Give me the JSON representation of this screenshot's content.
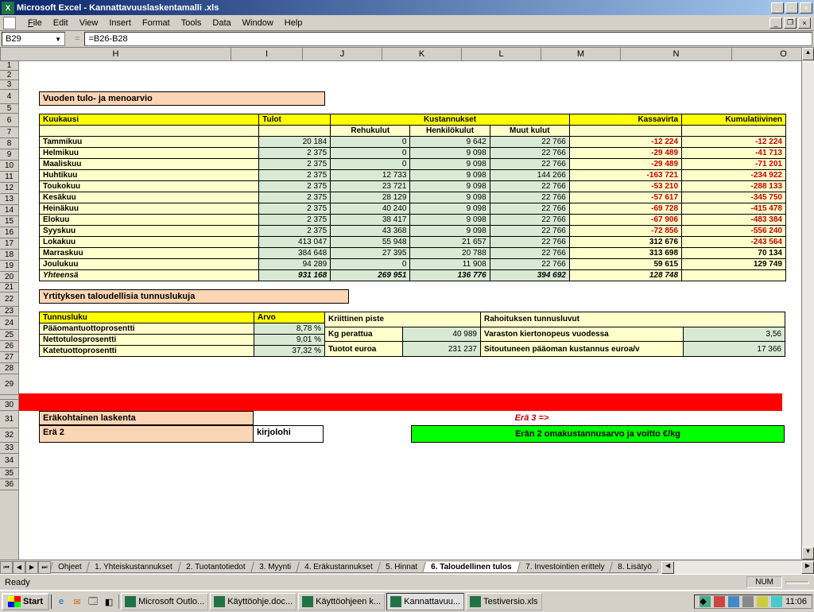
{
  "window": {
    "title": "Microsoft Excel - Kannattavuuslaskentamalli .xls"
  },
  "menu": {
    "file": "File",
    "edit": "Edit",
    "view": "View",
    "insert": "Insert",
    "format": "Format",
    "tools": "Tools",
    "data": "Data",
    "window": "Window",
    "help": "Help"
  },
  "namebox": "B29",
  "formula": "=B26-B28",
  "cols": [
    "H",
    "I",
    "J",
    "K",
    "L",
    "M",
    "N",
    "O"
  ],
  "rows": [
    "1",
    "2",
    "3",
    "4",
    "5",
    "6",
    "7",
    "8",
    "9",
    "10",
    "11",
    "12",
    "13",
    "14",
    "15",
    "16",
    "17",
    "18",
    "19",
    "20",
    "21",
    "22",
    "23",
    "24",
    "25",
    "26",
    "27",
    "28",
    "29",
    "",
    "30",
    "31",
    "32",
    "33",
    "34",
    "35",
    "36"
  ],
  "sec1_title": "Vuoden tulo- ja menoarvio",
  "headers": {
    "kuukausi": "Kuukausi",
    "tulot": "Tulot",
    "kustannukset": "Kustannukset",
    "rehu": "Rehukulut",
    "henkilo": "Henkilökulut",
    "muut": "Muut kulut",
    "kassa": "Kassavirta",
    "kumul": "Kumulatiivinen"
  },
  "months": [
    {
      "name": "Tammikuu",
      "tulot": "20 184",
      "rehu": "0",
      "henk": "9 642",
      "muut": "22 766",
      "kassa": "-12 224",
      "kumul": "-12 224"
    },
    {
      "name": "Helmikuu",
      "tulot": "2 375",
      "rehu": "0",
      "henk": "9 098",
      "muut": "22 766",
      "kassa": "-29 489",
      "kumul": "-41 713"
    },
    {
      "name": "Maaliskuu",
      "tulot": "2 375",
      "rehu": "0",
      "henk": "9 098",
      "muut": "22 766",
      "kassa": "-29 489",
      "kumul": "-71 201"
    },
    {
      "name": "Huhtikuu",
      "tulot": "2 375",
      "rehu": "12 733",
      "henk": "9 098",
      "muut": "144 266",
      "kassa": "-163 721",
      "kumul": "-234 922"
    },
    {
      "name": "Toukokuu",
      "tulot": "2 375",
      "rehu": "23 721",
      "henk": "9 098",
      "muut": "22 766",
      "kassa": "-53 210",
      "kumul": "-288 133"
    },
    {
      "name": "Kesäkuu",
      "tulot": "2 375",
      "rehu": "28 129",
      "henk": "9 098",
      "muut": "22 766",
      "kassa": "-57 617",
      "kumul": "-345 750"
    },
    {
      "name": "Heinäkuu",
      "tulot": "2 375",
      "rehu": "40 240",
      "henk": "9 098",
      "muut": "22 766",
      "kassa": "-69 728",
      "kumul": "-415 478"
    },
    {
      "name": "Elokuu",
      "tulot": "2 375",
      "rehu": "38 417",
      "henk": "9 098",
      "muut": "22 766",
      "kassa": "-67 906",
      "kumul": "-483 384"
    },
    {
      "name": "Syyskuu",
      "tulot": "2 375",
      "rehu": "43 368",
      "henk": "9 098",
      "muut": "22 766",
      "kassa": "-72 856",
      "kumul": "-556 240"
    },
    {
      "name": "Lokakuu",
      "tulot": "413 047",
      "rehu": "55 948",
      "henk": "21 657",
      "muut": "22 766",
      "kassa": "312 676",
      "kumul": "-243 564"
    },
    {
      "name": "Marraskuu",
      "tulot": "384 648",
      "rehu": "27 395",
      "henk": "20 788",
      "muut": "22 766",
      "kassa": "313 698",
      "kumul": "70 134"
    },
    {
      "name": "Joulukuu",
      "tulot": "94 289",
      "rehu": "0",
      "henk": "11 908",
      "muut": "22 766",
      "kassa": "59 615",
      "kumul": "129 749"
    }
  ],
  "totals": {
    "name": "Yhteensä",
    "tulot": "931 168",
    "rehu": "269 951",
    "henk": "136 776",
    "muut": "394 692",
    "kassa": "128 748",
    "kumul": ""
  },
  "sec2_title": "Yrtityksen taloudellisia tunnuslukuja",
  "tunnus": {
    "h1": "Tunnusluku",
    "h2": "Arvo",
    "r1": {
      "a": "Pääomantuottoprosentti",
      "b": "8,78 %"
    },
    "r2": {
      "a": "Nettotulosprosentti",
      "b": "9,01 %"
    },
    "r3": {
      "a": "Katetuottoprosentti",
      "b": "37,32 %"
    }
  },
  "side": {
    "h1": "Kriittinen piste",
    "h2": "Rahoituksen tunnusluvut",
    "r2a": "Kg perattua",
    "r2b": "40 989",
    "r2c": "Varaston kiertonopeus vuodessa",
    "r2d": "3,56",
    "r3a": "Tuotot euroa",
    "r3b": "231 237",
    "r3c": "Sitoutuneen pääoman kustannus euroa/v",
    "r3d": "17 366"
  },
  "sec3_title": "Eräkohtainen laskenta",
  "era2": {
    "label": "Erä 2",
    "value": "kirjolohi"
  },
  "era3_link": "Erä 3 =>",
  "green_label": "Erän 2 omakustannusarvo ja voitto €/kg",
  "tabs": [
    "Ohjeet",
    "1. Yhteiskustannukset",
    "2. Tuotantotiedot",
    "3. Myynti",
    "4. Eräkustannukset",
    "5. Hinnat",
    "6. Taloudellinen tulos",
    "7. Investointien erittely",
    "8. Lisätyö"
  ],
  "active_tab": 6,
  "status": {
    "ready": "Ready",
    "num": "NUM"
  },
  "taskbar": {
    "start": "Start",
    "tasks": [
      "Microsoft Outlo...",
      "Käyttöohje.doc...",
      "Käyttöohjeen k...",
      "Kannattavuu...",
      "Testiversio.xls"
    ],
    "active_task": 3,
    "time": "11:06"
  }
}
